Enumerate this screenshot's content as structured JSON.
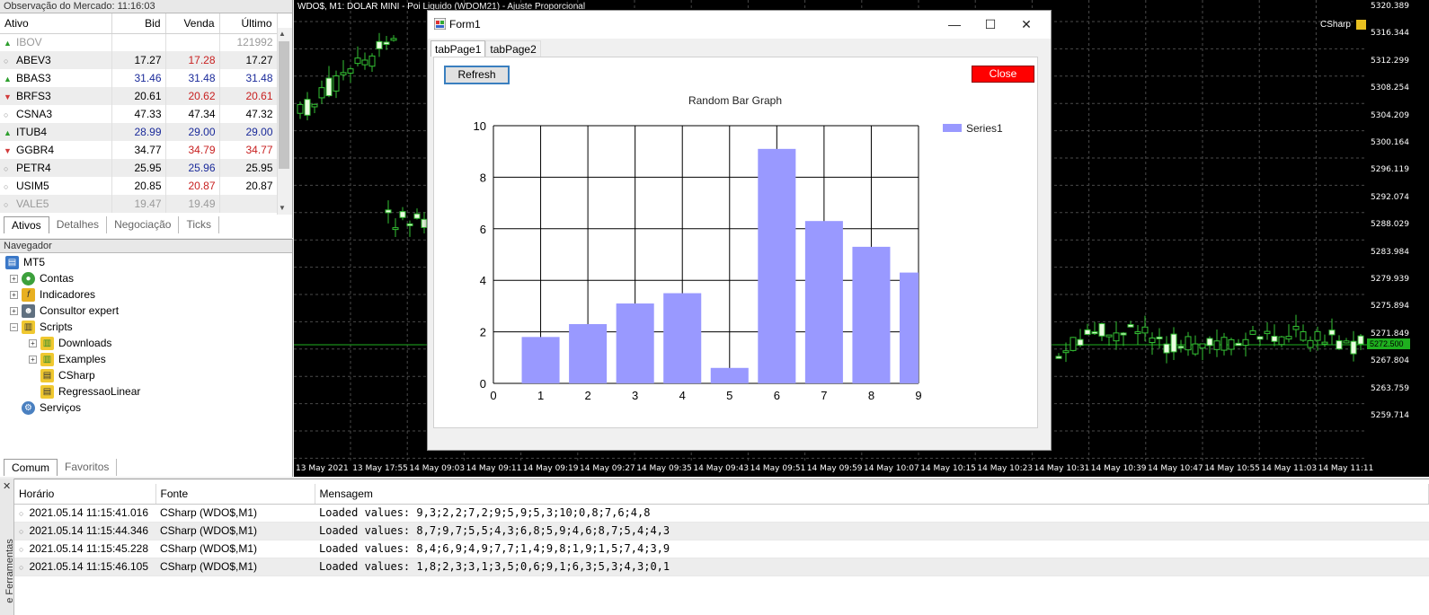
{
  "market_watch": {
    "title": "Observação do Mercado: 11:16:03",
    "columns": [
      "Ativo",
      "Bid",
      "Venda",
      "Último"
    ],
    "rows": [
      {
        "icon": "up",
        "symbol": "IBOV",
        "bid": "",
        "ask": "",
        "last": "121992"
      },
      {
        "icon": "circle",
        "symbol": "ABEV3",
        "bid": "17.27",
        "ask": "17.28",
        "last": "17.27"
      },
      {
        "icon": "up",
        "symbol": "BBAS3",
        "bid": "31.46",
        "ask": "31.48",
        "last": "31.48"
      },
      {
        "icon": "down",
        "symbol": "BRFS3",
        "bid": "20.61",
        "ask": "20.62",
        "last": "20.61"
      },
      {
        "icon": "circle",
        "symbol": "CSNA3",
        "bid": "47.33",
        "ask": "47.34",
        "last": "47.32"
      },
      {
        "icon": "up",
        "symbol": "ITUB4",
        "bid": "28.99",
        "ask": "29.00",
        "last": "29.00"
      },
      {
        "icon": "down",
        "symbol": "GGBR4",
        "bid": "34.77",
        "ask": "34.79",
        "last": "34.77"
      },
      {
        "icon": "circle",
        "symbol": "PETR4",
        "bid": "25.95",
        "ask": "25.96",
        "last": "25.95"
      },
      {
        "icon": "circle",
        "symbol": "USIM5",
        "bid": "20.85",
        "ask": "20.87",
        "last": "20.87"
      },
      {
        "icon": "circle",
        "symbol": "VALE5",
        "bid": "19.47",
        "ask": "19.49",
        "last": ""
      }
    ],
    "tabs": [
      "Ativos",
      "Detalhes",
      "Negociação",
      "Ticks"
    ]
  },
  "navigator": {
    "title": "Navegador",
    "items": [
      {
        "label": "MT5",
        "icon": "terminal-icon"
      },
      {
        "label": "Contas",
        "icon": "accounts-icon"
      },
      {
        "label": "Indicadores",
        "icon": "indicators-icon"
      },
      {
        "label": "Consultor expert",
        "icon": "expert-icon"
      },
      {
        "label": "Scripts",
        "icon": "scripts-icon"
      },
      {
        "label": "Downloads",
        "icon": "script-folder-icon"
      },
      {
        "label": "Examples",
        "icon": "script-folder-icon"
      },
      {
        "label": "CSharp",
        "icon": "script-icon"
      },
      {
        "label": "RegressaoLinear",
        "icon": "script-icon"
      },
      {
        "label": "Serviços",
        "icon": "services-icon"
      }
    ],
    "tabs": [
      "Comum",
      "Favoritos"
    ]
  },
  "chart": {
    "title": "WDO$, M1:  DOLAR MINI - Poi Liquido (WDOM21) - Ajuste Proporcional",
    "indicator_label": "CSharp",
    "current_price": "5272.500",
    "price_labels": [
      "5320.389",
      "5316.344",
      "5312.299",
      "5308.254",
      "5304.209",
      "5300.164",
      "5296.119",
      "5292.074",
      "5288.029",
      "5283.984",
      "5279.939",
      "5275.894",
      "5271.849",
      "5267.804",
      "5263.759",
      "5259.714"
    ],
    "time_labels": [
      "13 May 2021",
      "13 May 17:55",
      "14 May 09:03",
      "14 May 09:11",
      "14 May 09:19",
      "14 May 09:27",
      "14 May 09:35",
      "14 May 09:43",
      "14 May 09:51",
      "14 May 09:59",
      "14 May 10:07",
      "14 May 10:15",
      "14 May 10:23",
      "14 May 10:31",
      "14 May 10:39",
      "14 May 10:47",
      "14 May 10:55",
      "14 May 11:03",
      "14 May 11:11"
    ]
  },
  "form1": {
    "title": "Form1",
    "tabs": [
      "tabPage1",
      "tabPage2"
    ],
    "refresh_label": "Refresh",
    "close_label": "Close",
    "window_buttons": {
      "minimize": "—",
      "maximize": "☐",
      "close": "✕"
    }
  },
  "chart_data": {
    "type": "bar",
    "title": "Random Bar Graph",
    "x": [
      1,
      2,
      3,
      4,
      5,
      6,
      7,
      8,
      9
    ],
    "series": [
      {
        "name": "Series1",
        "values": [
          1.8,
          2.3,
          3.1,
          3.5,
          0.6,
          9.1,
          6.3,
          5.3,
          4.3
        ]
      }
    ],
    "xlim": [
      0,
      9
    ],
    "ylim": [
      0,
      10
    ],
    "xticks": [
      "0",
      "1",
      "2",
      "3",
      "4",
      "5",
      "6",
      "7",
      "8",
      "9"
    ],
    "yticks": [
      "0",
      "2",
      "4",
      "6",
      "8",
      "10"
    ],
    "grid": true,
    "legend": "top-right",
    "bar_color": "#9999ff"
  },
  "toolbox": {
    "side_label": "e Ferramentas",
    "columns": [
      "Horário",
      "Fonte",
      "Mensagem"
    ],
    "rows": [
      {
        "time": "2021.05.14 11:15:41.016",
        "source": "CSharp (WDO$,M1)",
        "message": "Loaded values: 9,3;2,2;7,2;9;5,9;5,3;10;0,8;7,6;4,8"
      },
      {
        "time": "2021.05.14 11:15:44.346",
        "source": "CSharp (WDO$,M1)",
        "message": "Loaded values: 8,7;9,7;5,5;4,3;6,8;5,9;4,6;8,7;5,4;4,3"
      },
      {
        "time": "2021.05.14 11:15:45.228",
        "source": "CSharp (WDO$,M1)",
        "message": "Loaded values: 8,4;6,9;4,9;7,7;1,4;9,8;1,9;1,5;7,4;3,9"
      },
      {
        "time": "2021.05.14 11:15:46.105",
        "source": "CSharp (WDO$,M1)",
        "message": "Loaded values: 1,8;2,3;3,1;3,5;0,6;9,1;6,3;5,3;4,3;0,1"
      }
    ]
  }
}
